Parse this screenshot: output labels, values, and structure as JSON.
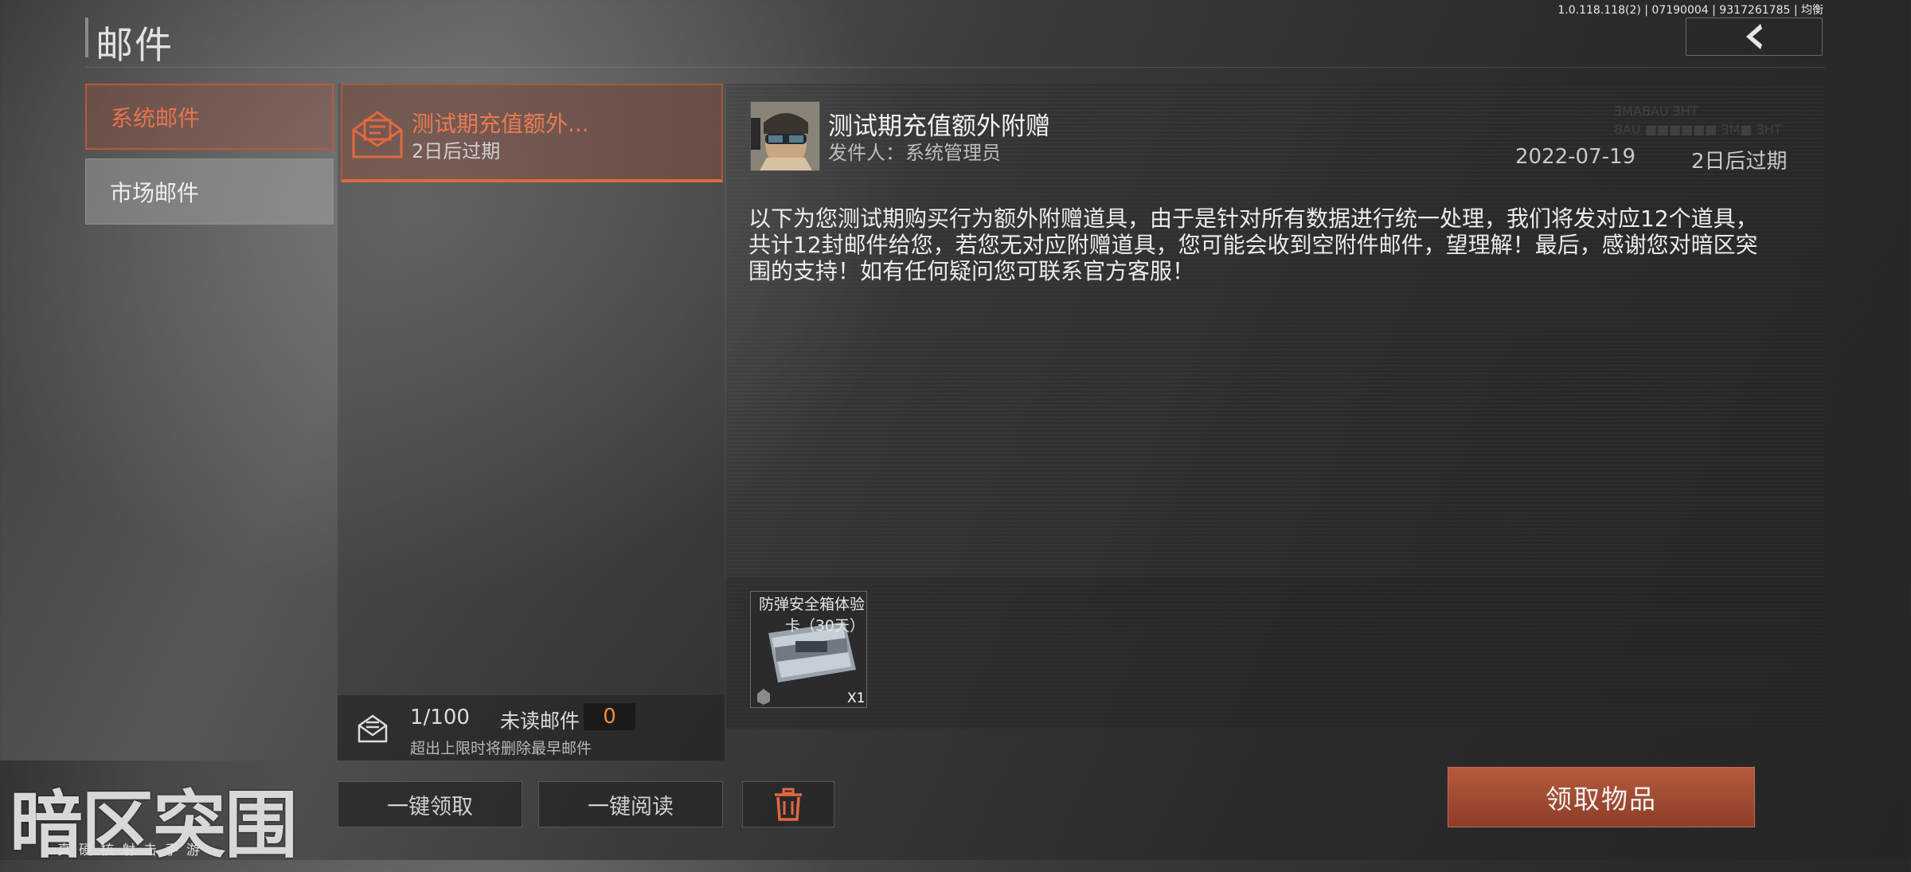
{
  "header": {
    "title": "邮件",
    "version": "1.0.118.118(2) | 07190004 | 9317261785 | 均衡"
  },
  "tabs": [
    {
      "label": "系统邮件",
      "active": true
    },
    {
      "label": "市场邮件",
      "active": false
    }
  ],
  "mail_list": {
    "items": [
      {
        "title": "测试期充值额外...",
        "subtitle": "2日后过期",
        "selected": true
      }
    ],
    "count": "1/100",
    "unread_label": "未读邮件",
    "unread_count": "0",
    "limit_note": "超出上限时将删除最早邮件",
    "buttons": {
      "claim_all": "一键领取",
      "read_all": "一键阅读",
      "delete_icon": "trash-icon"
    }
  },
  "detail": {
    "title": "测试期充值额外附赠",
    "sender_label": "发件人：",
    "sender": "系统管理员",
    "date": "2022-07-19",
    "expire": "2日后过期",
    "body": "以下为您测试期购买行为额外附赠道具，由于是针对所有数据进行统一处理，我们将发对应12个道具，共计12封邮件给您，若您无对应附赠道具，您可能会收到空附件邮件，望理解！最后，感谢您对暗区突围的支持！如有任何疑问您可联系官方客服！",
    "attachments": [
      {
        "name": "防弹安全箱体验卡（30天）",
        "qty": "X1"
      }
    ],
    "claim_button": "领取物品"
  },
  "logo": {
    "main": "暗区突围",
    "sub": "真硬核射击手游"
  },
  "colors": {
    "accent": "#e0683f",
    "button": "#a54a32",
    "unread": "#f08a3a"
  }
}
